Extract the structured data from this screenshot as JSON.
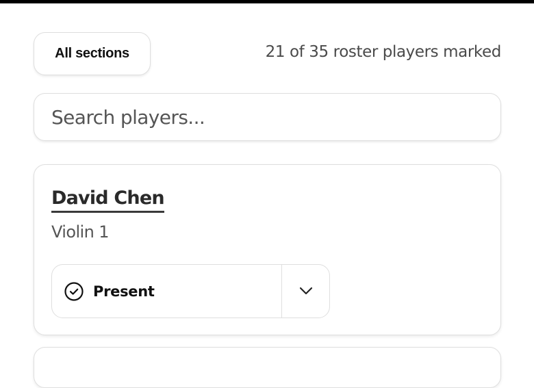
{
  "filter": {
    "section_button_label": "All sections",
    "marked_summary": "21 of 35 roster players marked"
  },
  "search": {
    "placeholder": "Search players..."
  },
  "players": [
    {
      "name": "David Chen",
      "section": "Violin 1",
      "status": "Present",
      "status_icon": "check-circle-icon",
      "toggle_icon": "chevron-down-icon"
    }
  ],
  "colors": {
    "top_bar": "#000000",
    "border": "#dedede",
    "text_primary": "#111111",
    "text_secondary": "#555555"
  }
}
